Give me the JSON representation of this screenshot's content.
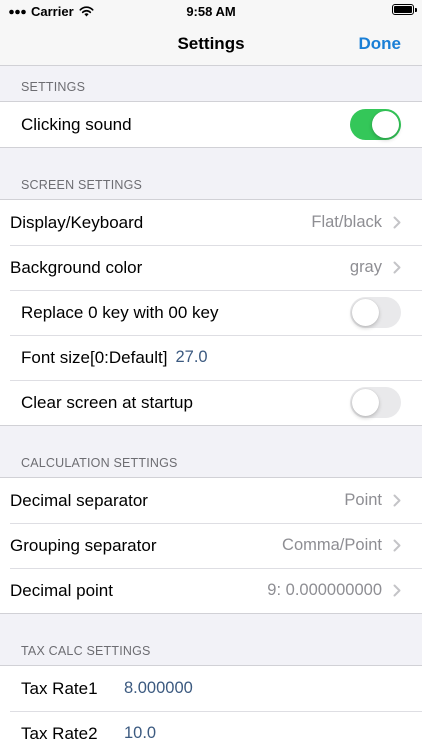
{
  "status": {
    "carrier": "Carrier",
    "time": "9:58 AM"
  },
  "nav": {
    "title": "Settings",
    "done": "Done"
  },
  "sections": {
    "settings": {
      "header": "SETTINGS",
      "clicking_sound": {
        "label": "Clicking sound",
        "on": true
      }
    },
    "screen": {
      "header": "SCREEN SETTINGS",
      "display_keyboard": {
        "label": "Display/Keyboard",
        "value": "Flat/black"
      },
      "background_color": {
        "label": "Background color",
        "value": "gray"
      },
      "replace_zero": {
        "label": "Replace 0 key with 00 key",
        "on": false
      },
      "font_size": {
        "label": "Font size[0:Default]",
        "value": "27.0"
      },
      "clear_screen": {
        "label": "Clear screen at startup",
        "on": false
      }
    },
    "calculation": {
      "header": "CALCULATION SETTINGS",
      "decimal_separator": {
        "label": "Decimal separator",
        "value": "Point"
      },
      "grouping_separator": {
        "label": "Grouping separator",
        "value": "Comma/Point"
      },
      "decimal_point": {
        "label": "Decimal point",
        "value": "9: 0.000000000"
      }
    },
    "tax": {
      "header": "TAX CALC SETTINGS",
      "rate1": {
        "label": "Tax Rate1",
        "value": "8.000000"
      },
      "rate2": {
        "label": "Tax Rate2",
        "value": "10.0"
      }
    }
  }
}
